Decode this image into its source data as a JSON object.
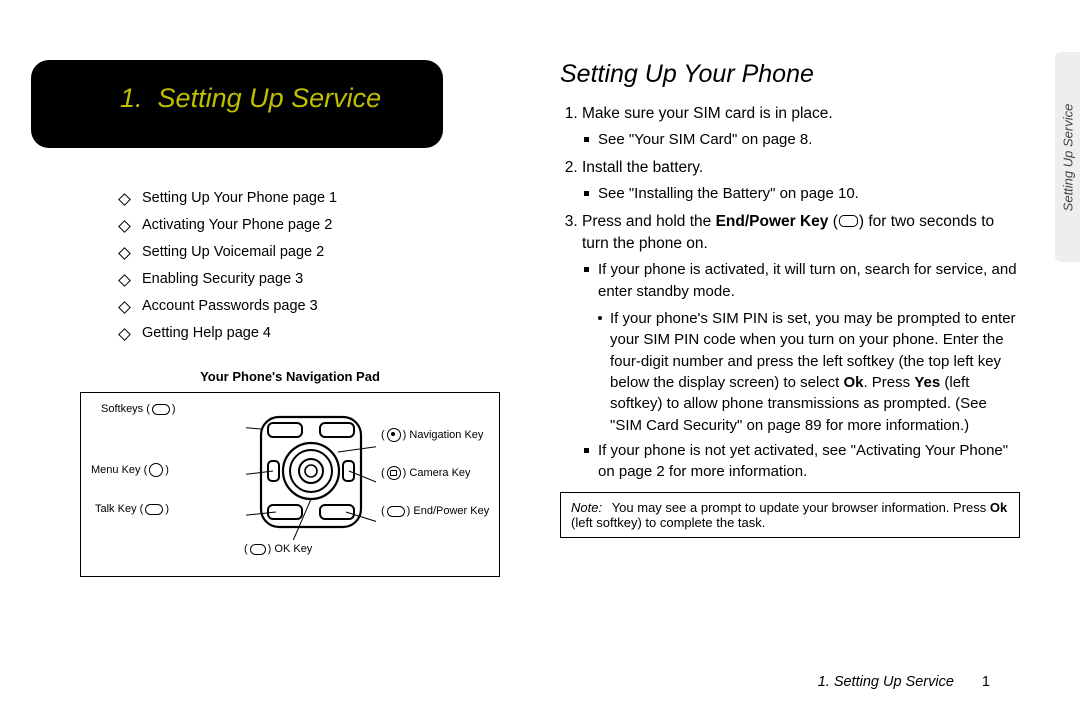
{
  "chapter": {
    "number": "1.",
    "title": "Setting Up Service"
  },
  "toc": [
    "Setting Up Your Phone page 1",
    "Activating Your Phone page 2",
    "Setting Up Voicemail page 2",
    "Enabling Security page 3",
    "Account Passwords page 3",
    "Getting Help page 4"
  ],
  "navpad": {
    "title": "Your Phone's Navigation Pad",
    "labels": {
      "softkeys": "Softkeys",
      "navkey": "Navigation Key",
      "menukey": "Menu Key",
      "camerakey": "Camera Key",
      "talkkey": "Talk Key",
      "endpower": "End/Power Key",
      "okkey": "OK Key"
    }
  },
  "section": {
    "title": "Setting Up Your Phone",
    "step1": "Make sure your SIM card is in place.",
    "step1a": "See \"Your SIM Card\" on page 8.",
    "step2": "Install the battery.",
    "step2a": "See \"Installing the Battery\" on page 10.",
    "step3_pre": "Press and hold the ",
    "step3_key": "End/Power Key",
    "step3_post": " for two seconds to turn the phone on.",
    "step3b1": "If your phone is activated, it will turn on, search for service, and enter standby mode.",
    "step3b2_pre": "If your phone's SIM PIN is set, you may be prompted to enter your SIM PIN code when you turn on your phone. Enter the four-digit number and press the left softkey (the top left key below the display screen) to select ",
    "step3b2_ok": "Ok",
    "step3b2_mid": ". Press ",
    "step3b2_yes": "Yes",
    "step3b2_post": " (left softkey) to allow phone transmissions as prompted. (See \"SIM Card Security\" on page 89 for more information.)",
    "step3b3": "If your phone is not yet activated, see \"Activating Your Phone\" on page 2 for more information."
  },
  "note": {
    "label": "Note:",
    "body_pre": "You may see a prompt to update your browser information. Press ",
    "body_ok": "Ok",
    "body_post": " (left softkey) to complete the task."
  },
  "footer": {
    "chapter": "1. Setting Up Service",
    "page": "1"
  },
  "sidetab": "Setting Up Service"
}
